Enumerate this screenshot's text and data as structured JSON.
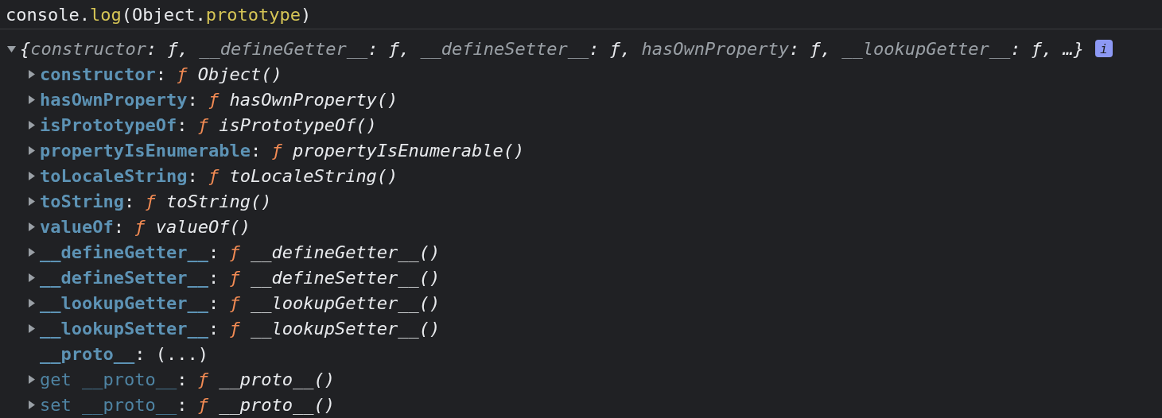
{
  "command": [
    {
      "text": "console.",
      "kind": "plain"
    },
    {
      "text": "log",
      "kind": "member"
    },
    {
      "text": "(Object.",
      "kind": "plain"
    },
    {
      "text": "prototype",
      "kind": "member"
    },
    {
      "text": ")",
      "kind": "plain"
    }
  ],
  "object": {
    "expanded": true,
    "open": "{",
    "entries": [
      {
        "key": "constructor",
        "separator": ": ",
        "value": "ƒ",
        "delimiter": ", "
      },
      {
        "key": "__defineGetter__",
        "separator": ": ",
        "value": "ƒ",
        "delimiter": ", "
      },
      {
        "key": "__defineSetter__",
        "separator": ": ",
        "value": "ƒ",
        "delimiter": ", "
      },
      {
        "key": "hasOwnProperty",
        "separator": ": ",
        "value": "ƒ",
        "delimiter": ", "
      },
      {
        "key": "__lookupGetter__",
        "separator": ": ",
        "value": "ƒ",
        "delimiter": ", "
      }
    ],
    "close": "…}",
    "info_badge": "i",
    "properties": [
      {
        "kind": "method",
        "expanded": false,
        "key": "constructor",
        "separator": ":",
        "marker": "ƒ",
        "value": "Object()"
      },
      {
        "kind": "method",
        "expanded": false,
        "key": "hasOwnProperty",
        "separator": ":",
        "marker": "ƒ",
        "value": "hasOwnProperty()"
      },
      {
        "kind": "method",
        "expanded": false,
        "key": "isPrototypeOf",
        "separator": ":",
        "marker": "ƒ",
        "value": "isPrototypeOf()"
      },
      {
        "kind": "method",
        "expanded": false,
        "key": "propertyIsEnumerable",
        "separator": ":",
        "marker": "ƒ",
        "value": "propertyIsEnumerable()"
      },
      {
        "kind": "method",
        "expanded": false,
        "key": "toLocaleString",
        "separator": ":",
        "marker": "ƒ",
        "value": "toLocaleString()"
      },
      {
        "kind": "method",
        "expanded": false,
        "key": "toString",
        "separator": ":",
        "marker": "ƒ",
        "value": "toString()"
      },
      {
        "kind": "method",
        "expanded": false,
        "key": "valueOf",
        "separator": ":",
        "marker": "ƒ",
        "value": "valueOf()"
      },
      {
        "kind": "method",
        "expanded": false,
        "key": "__defineGetter__",
        "separator": ":",
        "marker": "ƒ",
        "value": "__defineGetter__()"
      },
      {
        "kind": "method",
        "expanded": false,
        "key": "__defineSetter__",
        "separator": ":",
        "marker": "ƒ",
        "value": "__defineSetter__()"
      },
      {
        "kind": "method",
        "expanded": false,
        "key": "__lookupGetter__",
        "separator": ":",
        "marker": "ƒ",
        "value": "__lookupGetter__()"
      },
      {
        "kind": "method",
        "expanded": false,
        "key": "__lookupSetter__",
        "separator": ":",
        "marker": "ƒ",
        "value": "__lookupSetter__()"
      },
      {
        "kind": "lazy",
        "key": "__proto__",
        "separator": ":",
        "value": "(...)"
      },
      {
        "kind": "accessor",
        "expanded": false,
        "key": "get __proto__",
        "separator": ":",
        "marker": "ƒ",
        "value": "__proto__()"
      },
      {
        "kind": "accessor",
        "expanded": false,
        "key": "set __proto__",
        "separator": ":",
        "marker": "ƒ",
        "value": "__proto__()"
      }
    ]
  }
}
